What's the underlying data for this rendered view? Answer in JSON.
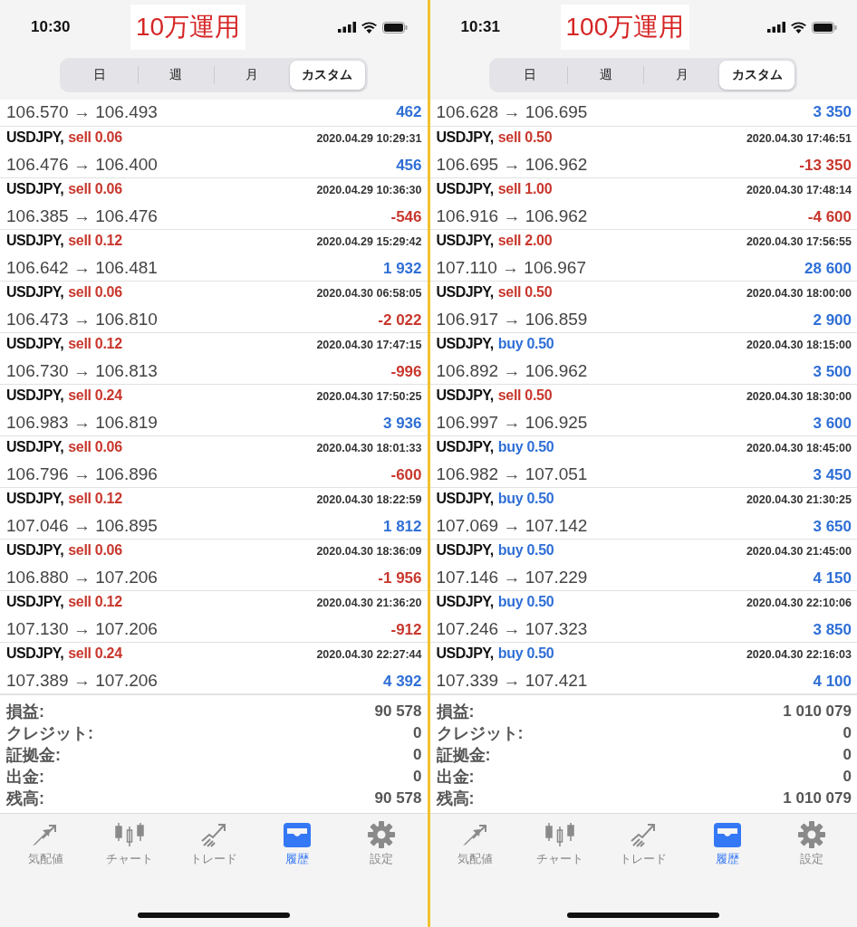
{
  "panels": [
    {
      "time": "10:30",
      "title": "10万運用",
      "tabs": [
        {
          "label": "日",
          "selected": false
        },
        {
          "label": "週",
          "selected": false
        },
        {
          "label": "月",
          "selected": false
        },
        {
          "label": "カスタム",
          "selected": true
        }
      ],
      "top_row": {
        "prices": "106.570 → 106.493",
        "profit": "462",
        "loss": false
      },
      "trades": [
        {
          "symbol": "USDJPY,",
          "side": "sell 0.06",
          "buy": false,
          "datetime": "2020.04.29 10:29:31",
          "prices": "106.476 → 106.400",
          "profit": "456",
          "loss": false
        },
        {
          "symbol": "USDJPY,",
          "side": "sell 0.06",
          "buy": false,
          "datetime": "2020.04.29 10:36:30",
          "prices": "106.385 → 106.476",
          "profit": "-546",
          "loss": true
        },
        {
          "symbol": "USDJPY,",
          "side": "sell 0.12",
          "buy": false,
          "datetime": "2020.04.29 15:29:42",
          "prices": "106.642 → 106.481",
          "profit": "1 932",
          "loss": false
        },
        {
          "symbol": "USDJPY,",
          "side": "sell 0.06",
          "buy": false,
          "datetime": "2020.04.30 06:58:05",
          "prices": "106.473 → 106.810",
          "profit": "-2 022",
          "loss": true
        },
        {
          "symbol": "USDJPY,",
          "side": "sell 0.12",
          "buy": false,
          "datetime": "2020.04.30 17:47:15",
          "prices": "106.730 → 106.813",
          "profit": "-996",
          "loss": true
        },
        {
          "symbol": "USDJPY,",
          "side": "sell 0.24",
          "buy": false,
          "datetime": "2020.04.30 17:50:25",
          "prices": "106.983 → 106.819",
          "profit": "3 936",
          "loss": false
        },
        {
          "symbol": "USDJPY,",
          "side": "sell 0.06",
          "buy": false,
          "datetime": "2020.04.30 18:01:33",
          "prices": "106.796 → 106.896",
          "profit": "-600",
          "loss": true
        },
        {
          "symbol": "USDJPY,",
          "side": "sell 0.12",
          "buy": false,
          "datetime": "2020.04.30 18:22:59",
          "prices": "107.046 → 106.895",
          "profit": "1 812",
          "loss": false
        },
        {
          "symbol": "USDJPY,",
          "side": "sell 0.06",
          "buy": false,
          "datetime": "2020.04.30 18:36:09",
          "prices": "106.880 → 107.206",
          "profit": "-1 956",
          "loss": true
        },
        {
          "symbol": "USDJPY,",
          "side": "sell 0.12",
          "buy": false,
          "datetime": "2020.04.30 21:36:20",
          "prices": "107.130 → 107.206",
          "profit": "-912",
          "loss": true
        },
        {
          "symbol": "USDJPY,",
          "side": "sell 0.24",
          "buy": false,
          "datetime": "2020.04.30 22:27:44",
          "prices": "107.389 → 107.206",
          "profit": "4 392",
          "loss": false
        }
      ],
      "summary": [
        {
          "label": "損益:",
          "value": "90 578"
        },
        {
          "label": "クレジット:",
          "value": "0"
        },
        {
          "label": "証拠金:",
          "value": "0"
        },
        {
          "label": "出金:",
          "value": "0"
        },
        {
          "label": "残高:",
          "value": "90 578"
        }
      ],
      "nav": [
        {
          "label": "気配値",
          "selected": false
        },
        {
          "label": "チャート",
          "selected": false
        },
        {
          "label": "トレード",
          "selected": false
        },
        {
          "label": "履歴",
          "selected": true
        },
        {
          "label": "設定",
          "selected": false
        }
      ]
    },
    {
      "time": "10:31",
      "title": "100万運用",
      "tabs": [
        {
          "label": "日",
          "selected": false
        },
        {
          "label": "週",
          "selected": false
        },
        {
          "label": "月",
          "selected": false
        },
        {
          "label": "カスタム",
          "selected": true
        }
      ],
      "top_row": {
        "prices": "106.628 → 106.695",
        "profit": "3 350",
        "loss": false
      },
      "trades": [
        {
          "symbol": "USDJPY,",
          "side": "sell 0.50",
          "buy": false,
          "datetime": "2020.04.30 17:46:51",
          "prices": "106.695 → 106.962",
          "profit": "-13 350",
          "loss": true
        },
        {
          "symbol": "USDJPY,",
          "side": "sell 1.00",
          "buy": false,
          "datetime": "2020.04.30 17:48:14",
          "prices": "106.916 → 106.962",
          "profit": "-4 600",
          "loss": true
        },
        {
          "symbol": "USDJPY,",
          "side": "sell 2.00",
          "buy": false,
          "datetime": "2020.04.30 17:56:55",
          "prices": "107.110 → 106.967",
          "profit": "28 600",
          "loss": false
        },
        {
          "symbol": "USDJPY,",
          "side": "sell 0.50",
          "buy": false,
          "datetime": "2020.04.30 18:00:00",
          "prices": "106.917 → 106.859",
          "profit": "2 900",
          "loss": false
        },
        {
          "symbol": "USDJPY,",
          "side": "buy 0.50",
          "buy": true,
          "datetime": "2020.04.30 18:15:00",
          "prices": "106.892 → 106.962",
          "profit": "3 500",
          "loss": false
        },
        {
          "symbol": "USDJPY,",
          "side": "sell 0.50",
          "buy": false,
          "datetime": "2020.04.30 18:30:00",
          "prices": "106.997 → 106.925",
          "profit": "3 600",
          "loss": false
        },
        {
          "symbol": "USDJPY,",
          "side": "buy 0.50",
          "buy": true,
          "datetime": "2020.04.30 18:45:00",
          "prices": "106.982 → 107.051",
          "profit": "3 450",
          "loss": false
        },
        {
          "symbol": "USDJPY,",
          "side": "buy 0.50",
          "buy": true,
          "datetime": "2020.04.30 21:30:25",
          "prices": "107.069 → 107.142",
          "profit": "3 650",
          "loss": false
        },
        {
          "symbol": "USDJPY,",
          "side": "buy 0.50",
          "buy": true,
          "datetime": "2020.04.30 21:45:00",
          "prices": "107.146 → 107.229",
          "profit": "4 150",
          "loss": false
        },
        {
          "symbol": "USDJPY,",
          "side": "buy 0.50",
          "buy": true,
          "datetime": "2020.04.30 22:10:06",
          "prices": "107.246 → 107.323",
          "profit": "3 850",
          "loss": false
        },
        {
          "symbol": "USDJPY,",
          "side": "buy 0.50",
          "buy": true,
          "datetime": "2020.04.30 22:16:03",
          "prices": "107.339 → 107.421",
          "profit": "4 100",
          "loss": false
        }
      ],
      "summary": [
        {
          "label": "損益:",
          "value": "1 010 079"
        },
        {
          "label": "クレジット:",
          "value": "0"
        },
        {
          "label": "証拠金:",
          "value": "0"
        },
        {
          "label": "出金:",
          "value": "0"
        },
        {
          "label": "残高:",
          "value": "1 010 079"
        }
      ],
      "nav": [
        {
          "label": "気配値",
          "selected": false
        },
        {
          "label": "チャート",
          "selected": false
        },
        {
          "label": "トレード",
          "selected": false
        },
        {
          "label": "履歴",
          "selected": true
        },
        {
          "label": "設定",
          "selected": false
        }
      ]
    }
  ]
}
